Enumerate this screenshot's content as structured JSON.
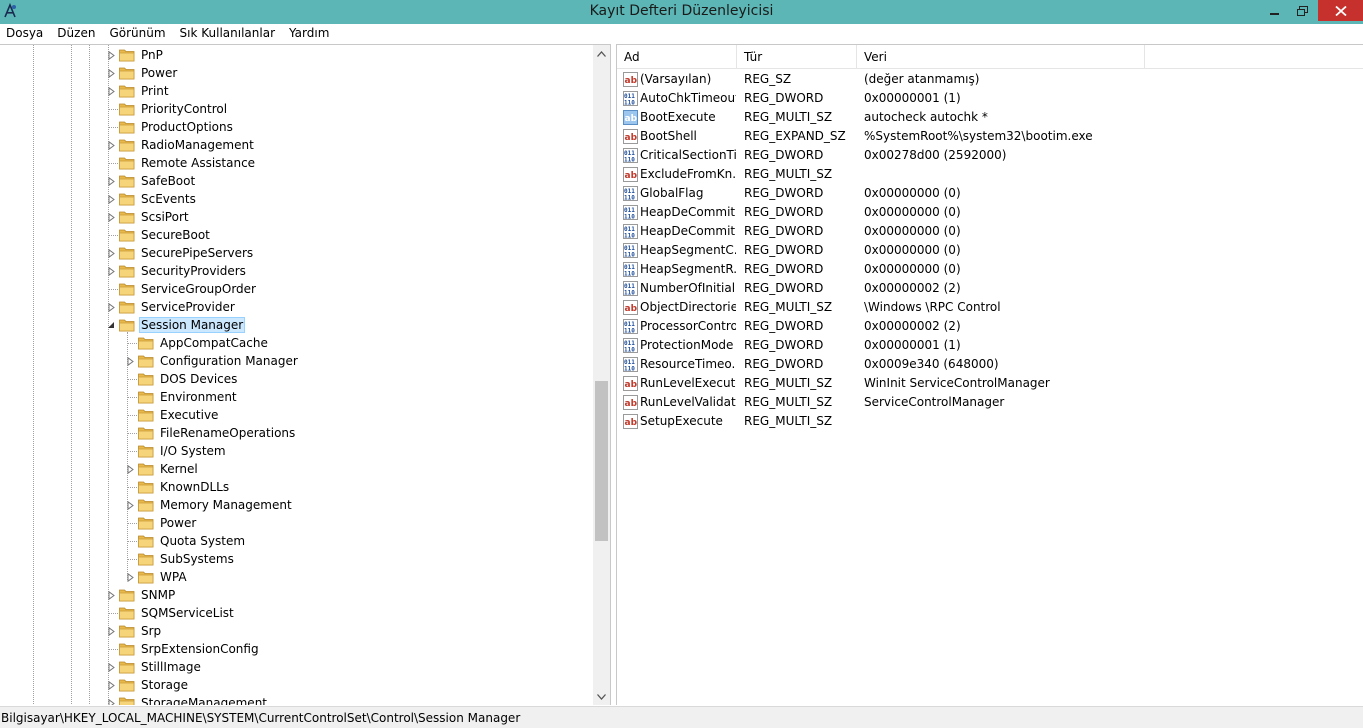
{
  "window": {
    "title": "Kayıt Defteri Düzenleyicisi",
    "app_icon": "regedit-icon",
    "controls": [
      "minimize-icon",
      "maximize-icon",
      "close-icon"
    ],
    "colors": {
      "titlebar": "#5bb6b5",
      "close_button": "#c7312d",
      "selection": "#cce8ff"
    }
  },
  "menu": [
    "Dosya",
    "Düzen",
    "Görünüm",
    "Sık Kullanılanlar",
    "Yardım"
  ],
  "tree": {
    "items": [
      {
        "label": "PnP",
        "expandable": true
      },
      {
        "label": "Power",
        "expandable": true
      },
      {
        "label": "Print",
        "expandable": true
      },
      {
        "label": "PriorityControl",
        "expandable": false
      },
      {
        "label": "ProductOptions",
        "expandable": false
      },
      {
        "label": "RadioManagement",
        "expandable": true
      },
      {
        "label": "Remote Assistance",
        "expandable": false
      },
      {
        "label": "SafeBoot",
        "expandable": true
      },
      {
        "label": "ScEvents",
        "expandable": true
      },
      {
        "label": "ScsiPort",
        "expandable": true
      },
      {
        "label": "SecureBoot",
        "expandable": false
      },
      {
        "label": "SecurePipeServers",
        "expandable": true
      },
      {
        "label": "SecurityProviders",
        "expandable": true
      },
      {
        "label": "ServiceGroupOrder",
        "expandable": false
      },
      {
        "label": "ServiceProvider",
        "expandable": true
      },
      {
        "label": "Session Manager",
        "expandable": true,
        "expanded": true,
        "selected": true
      },
      {
        "label": "AppCompatCache",
        "expandable": false,
        "child": true
      },
      {
        "label": "Configuration Manager",
        "expandable": true,
        "child": true
      },
      {
        "label": "DOS Devices",
        "expandable": false,
        "child": true
      },
      {
        "label": "Environment",
        "expandable": false,
        "child": true
      },
      {
        "label": "Executive",
        "expandable": false,
        "child": true
      },
      {
        "label": "FileRenameOperations",
        "expandable": false,
        "child": true
      },
      {
        "label": "I/O System",
        "expandable": false,
        "child": true
      },
      {
        "label": "Kernel",
        "expandable": true,
        "child": true
      },
      {
        "label": "KnownDLLs",
        "expandable": false,
        "child": true
      },
      {
        "label": "Memory Management",
        "expandable": true,
        "child": true
      },
      {
        "label": "Power",
        "expandable": false,
        "child": true
      },
      {
        "label": "Quota System",
        "expandable": false,
        "child": true
      },
      {
        "label": "SubSystems",
        "expandable": false,
        "child": true
      },
      {
        "label": "WPA",
        "expandable": true,
        "child": true
      },
      {
        "label": "SNMP",
        "expandable": true
      },
      {
        "label": "SQMServiceList",
        "expandable": false
      },
      {
        "label": "Srp",
        "expandable": true
      },
      {
        "label": "SrpExtensionConfig",
        "expandable": false
      },
      {
        "label": "StillImage",
        "expandable": true
      },
      {
        "label": "Storage",
        "expandable": true
      },
      {
        "label": "StorageManagement",
        "expandable": true
      }
    ]
  },
  "list": {
    "columns": [
      "Ad",
      "Tür",
      "Veri"
    ],
    "rows": [
      {
        "icon": "string-value-icon",
        "name": "(Varsayılan)",
        "type": "REG_SZ",
        "data": "(değer atanmamış)"
      },
      {
        "icon": "binary-value-icon",
        "name": "AutoChkTimeout",
        "type": "REG_DWORD",
        "data": "0x00000001 (1)"
      },
      {
        "icon": "string-value-icon",
        "name": "BootExecute",
        "type": "REG_MULTI_SZ",
        "data": "autocheck autochk *",
        "highlight": true
      },
      {
        "icon": "string-value-icon",
        "name": "BootShell",
        "type": "REG_EXPAND_SZ",
        "data": "%SystemRoot%\\system32\\bootim.exe"
      },
      {
        "icon": "binary-value-icon",
        "name": "CriticalSectionTi...",
        "type": "REG_DWORD",
        "data": "0x00278d00 (2592000)"
      },
      {
        "icon": "string-value-icon",
        "name": "ExcludeFromKn...",
        "type": "REG_MULTI_SZ",
        "data": ""
      },
      {
        "icon": "binary-value-icon",
        "name": "GlobalFlag",
        "type": "REG_DWORD",
        "data": "0x00000000 (0)"
      },
      {
        "icon": "binary-value-icon",
        "name": "HeapDeCommit...",
        "type": "REG_DWORD",
        "data": "0x00000000 (0)"
      },
      {
        "icon": "binary-value-icon",
        "name": "HeapDeCommit...",
        "type": "REG_DWORD",
        "data": "0x00000000 (0)"
      },
      {
        "icon": "binary-value-icon",
        "name": "HeapSegmentC...",
        "type": "REG_DWORD",
        "data": "0x00000000 (0)"
      },
      {
        "icon": "binary-value-icon",
        "name": "HeapSegmentR...",
        "type": "REG_DWORD",
        "data": "0x00000000 (0)"
      },
      {
        "icon": "binary-value-icon",
        "name": "NumberOfInitial...",
        "type": "REG_DWORD",
        "data": "0x00000002 (2)"
      },
      {
        "icon": "string-value-icon",
        "name": "ObjectDirectories",
        "type": "REG_MULTI_SZ",
        "data": "\\Windows \\RPC Control"
      },
      {
        "icon": "binary-value-icon",
        "name": "ProcessorControl",
        "type": "REG_DWORD",
        "data": "0x00000002 (2)"
      },
      {
        "icon": "binary-value-icon",
        "name": "ProtectionMode",
        "type": "REG_DWORD",
        "data": "0x00000001 (1)"
      },
      {
        "icon": "binary-value-icon",
        "name": "ResourceTimeo...",
        "type": "REG_DWORD",
        "data": "0x0009e340 (648000)"
      },
      {
        "icon": "string-value-icon",
        "name": "RunLevelExecute",
        "type": "REG_MULTI_SZ",
        "data": "WinInit ServiceControlManager"
      },
      {
        "icon": "string-value-icon",
        "name": "RunLevelValidate",
        "type": "REG_MULTI_SZ",
        "data": "ServiceControlManager"
      },
      {
        "icon": "string-value-icon",
        "name": "SetupExecute",
        "type": "REG_MULTI_SZ",
        "data": ""
      }
    ]
  },
  "status": {
    "path": "Bilgisayar\\HKEY_LOCAL_MACHINE\\SYSTEM\\CurrentControlSet\\Control\\Session Manager"
  }
}
